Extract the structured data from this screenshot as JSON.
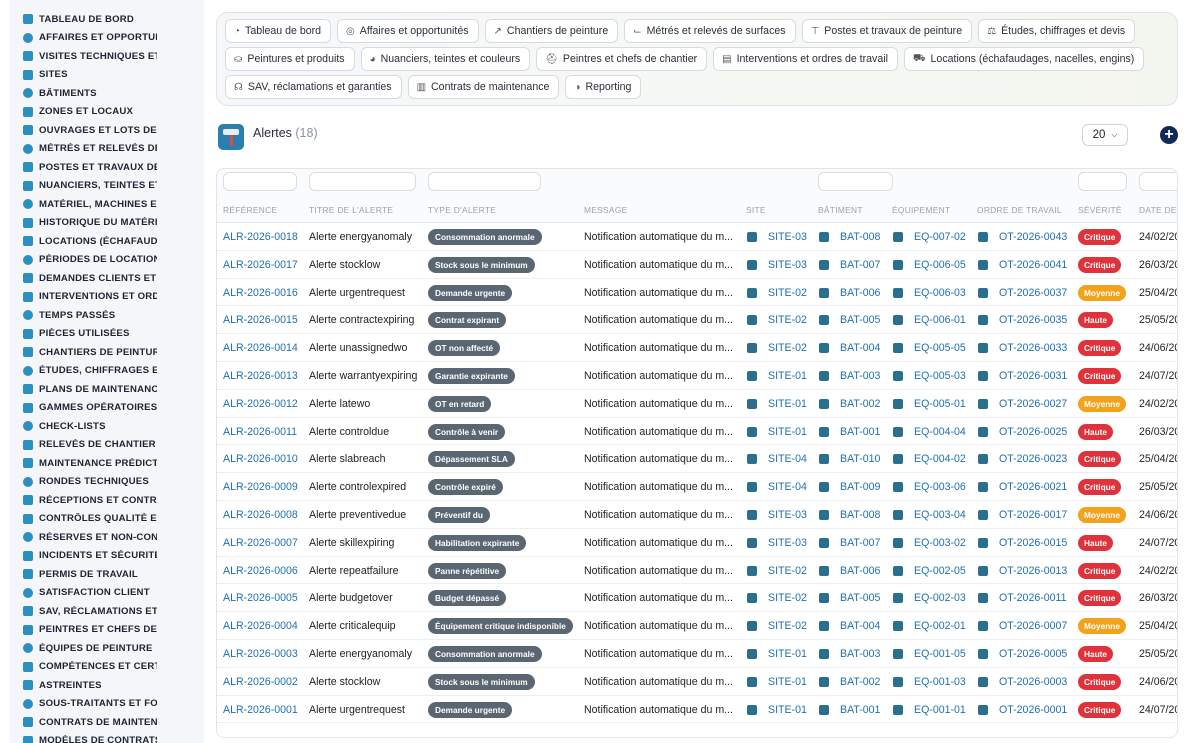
{
  "sidebar": {
    "items": [
      {
        "label": "TABLEAU DE BORD",
        "icon": "dashboard-icon"
      },
      {
        "label": "AFFAIRES ET OPPORTUNITÉS",
        "icon": "target-icon"
      },
      {
        "label": "VISITES TECHNIQUES ET",
        "icon": "clipboard-icon"
      },
      {
        "label": "SITES",
        "icon": "map-pin-icon"
      },
      {
        "label": "BÂTIMENTS",
        "icon": "building-icon"
      },
      {
        "label": "ZONES ET LOCAUX",
        "icon": "zone-icon"
      },
      {
        "label": "OUVRAGES ET LOTS DE TRAVAUX",
        "icon": "sitemap-icon"
      },
      {
        "label": "MÉTRÉS ET RELEVÉS DE SURFACES",
        "icon": "ruler-icon"
      },
      {
        "label": "POSTES ET TRAVAUX DE PEINTURE",
        "icon": "paint-roller-icon"
      },
      {
        "label": "NUANCIERS, TEINTES ET COULEURS",
        "icon": "palette-icon"
      },
      {
        "label": "MATÉRIEL, MACHINES ET OUTILLAGE",
        "icon": "gears-icon"
      },
      {
        "label": "HISTORIQUE DU MATÉRIEL",
        "icon": "history-icon"
      },
      {
        "label": "LOCATIONS (ÉCHAFAUDAGES)",
        "icon": "truck-icon"
      },
      {
        "label": "PÉRIODES DE LOCATION",
        "icon": "calendar-icon"
      },
      {
        "label": "DEMANDES CLIENTS ET INTERVENTIONS",
        "icon": "inbox-icon"
      },
      {
        "label": "INTERVENTIONS ET ORDRES DE TRAVAIL",
        "icon": "clipboard-check-icon"
      },
      {
        "label": "TEMPS PASSÉS",
        "icon": "clock-icon"
      },
      {
        "label": "PIÈCES UTILISÉES",
        "icon": "box-icon"
      },
      {
        "label": "CHANTIERS DE PEINTURE",
        "icon": "brush-icon"
      },
      {
        "label": "ÉTUDES, CHIFFRAGES ET DEVIS",
        "icon": "scale-icon"
      },
      {
        "label": "PLANS DE MAINTENANCE",
        "icon": "list-icon"
      },
      {
        "label": "GAMMES OPÉRATOIRES",
        "icon": "stack-icon"
      },
      {
        "label": "CHECK-LISTS",
        "icon": "checklist-icon"
      },
      {
        "label": "RELEVÉS DE CHANTIER",
        "icon": "file-icon"
      },
      {
        "label": "MAINTENANCE PRÉDICTIVE",
        "icon": "chart-icon"
      },
      {
        "label": "RONDES TECHNIQUES",
        "icon": "search-icon"
      },
      {
        "label": "RÉCEPTIONS ET CONTRÔLES",
        "icon": "receipt-icon"
      },
      {
        "label": "CONTRÔLES QUALITÉ ET",
        "icon": "quality-icon"
      },
      {
        "label": "RÉSERVES ET NON-CONFORMITÉS",
        "icon": "alert-circle-icon"
      },
      {
        "label": "INCIDENTS ET SÉCURITÉ",
        "icon": "warning-icon"
      },
      {
        "label": "PERMIS DE TRAVAIL",
        "icon": "permit-icon"
      },
      {
        "label": "SATISFACTION CLIENT",
        "icon": "smile-icon"
      },
      {
        "label": "SAV, RÉCLAMATIONS ET GARANTIES",
        "icon": "headset-icon"
      },
      {
        "label": "PEINTRES ET CHEFS DE CHANTIER",
        "icon": "helmet-icon"
      },
      {
        "label": "ÉQUIPES DE PEINTURE",
        "icon": "users-icon"
      },
      {
        "label": "COMPÉTENCES ET CERTIFICATIONS",
        "icon": "certificate-icon"
      },
      {
        "label": "ASTREINTES",
        "icon": "phone-icon"
      },
      {
        "label": "SOUS-TRAITANTS ET FOURNISSEURS",
        "icon": "handshake-icon"
      },
      {
        "label": "CONTRATS DE MAINTENANCE",
        "icon": "contract-icon"
      },
      {
        "label": "MODÈLES DE CONTRATS",
        "icon": "template-icon"
      }
    ]
  },
  "modules": {
    "rows": [
      [
        {
          "label": "Tableau de bord",
          "icon": "dashboard-icon"
        },
        {
          "label": "Affaires et opportunités",
          "icon": "target-icon"
        },
        {
          "label": "Chantiers de peinture",
          "icon": "brush-icon"
        },
        {
          "label": "Métrés et relevés de surfaces",
          "icon": "ruler-icon"
        },
        {
          "label": "Postes et travaux de peinture",
          "icon": "paint-roller-icon"
        },
        {
          "label": "Études, chiffrages et devis",
          "icon": "scale-icon"
        }
      ],
      [
        {
          "label": "Peintures et produits",
          "icon": "bucket-icon"
        },
        {
          "label": "Nuanciers, teintes et couleurs",
          "icon": "palette-icon"
        },
        {
          "label": "Peintres et chefs de chantier",
          "icon": "helmet-icon"
        },
        {
          "label": "Interventions et ordres de travail",
          "icon": "clipboard-check-icon"
        },
        {
          "label": "Locations (échafaudages, nacelles, engins)",
          "icon": "truck-icon"
        }
      ],
      [
        {
          "label": "SAV, réclamations et garanties",
          "icon": "headset-icon"
        },
        {
          "label": "Contrats de maintenance",
          "icon": "contract-icon"
        },
        {
          "label": "Reporting",
          "icon": "pie-chart-icon"
        }
      ]
    ]
  },
  "header": {
    "title": "Alertes",
    "count": "(18)",
    "per_page": "20"
  },
  "table": {
    "columns": [
      "RÉFÉRENCE",
      "TITRE DE L'ALERTE",
      "TYPE D'ALERTE",
      "MESSAGE",
      "SITE",
      "BÂTIMENT",
      "ÉQUIPEMENT",
      "ORDRE DE TRAVAIL",
      "SÉVÉRITÉ",
      "DATE DE"
    ],
    "severity_colors": {
      "Critique": "#e0323a",
      "Haute": "#e0323a",
      "Moyenne": "#f2a21b"
    },
    "rows": [
      {
        "ref": "ALR-2026-0018",
        "title": "Alerte energyanomaly",
        "type": "Consommation anormale",
        "message": "Notification automatique du m...",
        "site": "SITE-03",
        "building": "BAT-008",
        "equipment": "EQ-007-02",
        "work_order": "OT-2026-0043",
        "severity": "Critique",
        "date": "24/02/20"
      },
      {
        "ref": "ALR-2026-0017",
        "title": "Alerte stocklow",
        "type": "Stock sous le minimum",
        "message": "Notification automatique du m...",
        "site": "SITE-03",
        "building": "BAT-007",
        "equipment": "EQ-006-05",
        "work_order": "OT-2026-0041",
        "severity": "Critique",
        "date": "26/03/20"
      },
      {
        "ref": "ALR-2026-0016",
        "title": "Alerte urgentrequest",
        "type": "Demande urgente",
        "message": "Notification automatique du m...",
        "site": "SITE-02",
        "building": "BAT-006",
        "equipment": "EQ-006-03",
        "work_order": "OT-2026-0037",
        "severity": "Moyenne",
        "date": "25/04/20"
      },
      {
        "ref": "ALR-2026-0015",
        "title": "Alerte contractexpiring",
        "type": "Contrat expirant",
        "message": "Notification automatique du m...",
        "site": "SITE-02",
        "building": "BAT-005",
        "equipment": "EQ-006-01",
        "work_order": "OT-2026-0035",
        "severity": "Haute",
        "date": "25/05/20"
      },
      {
        "ref": "ALR-2026-0014",
        "title": "Alerte unassignedwo",
        "type": "OT non affecté",
        "message": "Notification automatique du m...",
        "site": "SITE-02",
        "building": "BAT-004",
        "equipment": "EQ-005-05",
        "work_order": "OT-2026-0033",
        "severity": "Critique",
        "date": "24/06/20"
      },
      {
        "ref": "ALR-2026-0013",
        "title": "Alerte warrantyexpiring",
        "type": "Garantie expirante",
        "message": "Notification automatique du m...",
        "site": "SITE-01",
        "building": "BAT-003",
        "equipment": "EQ-005-03",
        "work_order": "OT-2026-0031",
        "severity": "Critique",
        "date": "24/07/20"
      },
      {
        "ref": "ALR-2026-0012",
        "title": "Alerte latewo",
        "type": "OT en retard",
        "message": "Notification automatique du m...",
        "site": "SITE-01",
        "building": "BAT-002",
        "equipment": "EQ-005-01",
        "work_order": "OT-2026-0027",
        "severity": "Moyenne",
        "date": "24/02/20"
      },
      {
        "ref": "ALR-2026-0011",
        "title": "Alerte controldue",
        "type": "Contrôle à venir",
        "message": "Notification automatique du m...",
        "site": "SITE-01",
        "building": "BAT-001",
        "equipment": "EQ-004-04",
        "work_order": "OT-2026-0025",
        "severity": "Haute",
        "date": "26/03/20"
      },
      {
        "ref": "ALR-2026-0010",
        "title": "Alerte slabreach",
        "type": "Dépassement SLA",
        "message": "Notification automatique du m...",
        "site": "SITE-04",
        "building": "BAT-010",
        "equipment": "EQ-004-02",
        "work_order": "OT-2026-0023",
        "severity": "Critique",
        "date": "25/04/20"
      },
      {
        "ref": "ALR-2026-0009",
        "title": "Alerte controlexpired",
        "type": "Contrôle expiré",
        "message": "Notification automatique du m...",
        "site": "SITE-04",
        "building": "BAT-009",
        "equipment": "EQ-003-06",
        "work_order": "OT-2026-0021",
        "severity": "Critique",
        "date": "25/05/20"
      },
      {
        "ref": "ALR-2026-0008",
        "title": "Alerte preventivedue",
        "type": "Préventif du",
        "message": "Notification automatique du m...",
        "site": "SITE-03",
        "building": "BAT-008",
        "equipment": "EQ-003-04",
        "work_order": "OT-2026-0017",
        "severity": "Moyenne",
        "date": "24/06/20"
      },
      {
        "ref": "ALR-2026-0007",
        "title": "Alerte skillexpiring",
        "type": "Habilitation expirante",
        "message": "Notification automatique du m...",
        "site": "SITE-03",
        "building": "BAT-007",
        "equipment": "EQ-003-02",
        "work_order": "OT-2026-0015",
        "severity": "Haute",
        "date": "24/07/20"
      },
      {
        "ref": "ALR-2026-0006",
        "title": "Alerte repeatfailure",
        "type": "Panne répétitive",
        "message": "Notification automatique du m...",
        "site": "SITE-02",
        "building": "BAT-006",
        "equipment": "EQ-002-05",
        "work_order": "OT-2026-0013",
        "severity": "Critique",
        "date": "24/02/20"
      },
      {
        "ref": "ALR-2026-0005",
        "title": "Alerte budgetover",
        "type": "Budget dépassé",
        "message": "Notification automatique du m...",
        "site": "SITE-02",
        "building": "BAT-005",
        "equipment": "EQ-002-03",
        "work_order": "OT-2026-0011",
        "severity": "Critique",
        "date": "26/03/20"
      },
      {
        "ref": "ALR-2026-0004",
        "title": "Alerte criticalequip",
        "type": "Équipement critique indisponible",
        "message": "Notification automatique du m...",
        "site": "SITE-02",
        "building": "BAT-004",
        "equipment": "EQ-002-01",
        "work_order": "OT-2026-0007",
        "severity": "Moyenne",
        "date": "25/04/20"
      },
      {
        "ref": "ALR-2026-0003",
        "title": "Alerte energyanomaly",
        "type": "Consommation anormale",
        "message": "Notification automatique du m...",
        "site": "SITE-01",
        "building": "BAT-003",
        "equipment": "EQ-001-05",
        "work_order": "OT-2026-0005",
        "severity": "Haute",
        "date": "25/05/20"
      },
      {
        "ref": "ALR-2026-0002",
        "title": "Alerte stocklow",
        "type": "Stock sous le minimum",
        "message": "Notification automatique du m...",
        "site": "SITE-01",
        "building": "BAT-002",
        "equipment": "EQ-001-03",
        "work_order": "OT-2026-0003",
        "severity": "Critique",
        "date": "24/06/20"
      },
      {
        "ref": "ALR-2026-0001",
        "title": "Alerte urgentrequest",
        "type": "Demande urgente",
        "message": "Notification automatique du m...",
        "site": "SITE-01",
        "building": "BAT-001",
        "equipment": "EQ-001-01",
        "work_order": "OT-2026-0001",
        "severity": "Critique",
        "date": "24/07/20"
      }
    ]
  }
}
